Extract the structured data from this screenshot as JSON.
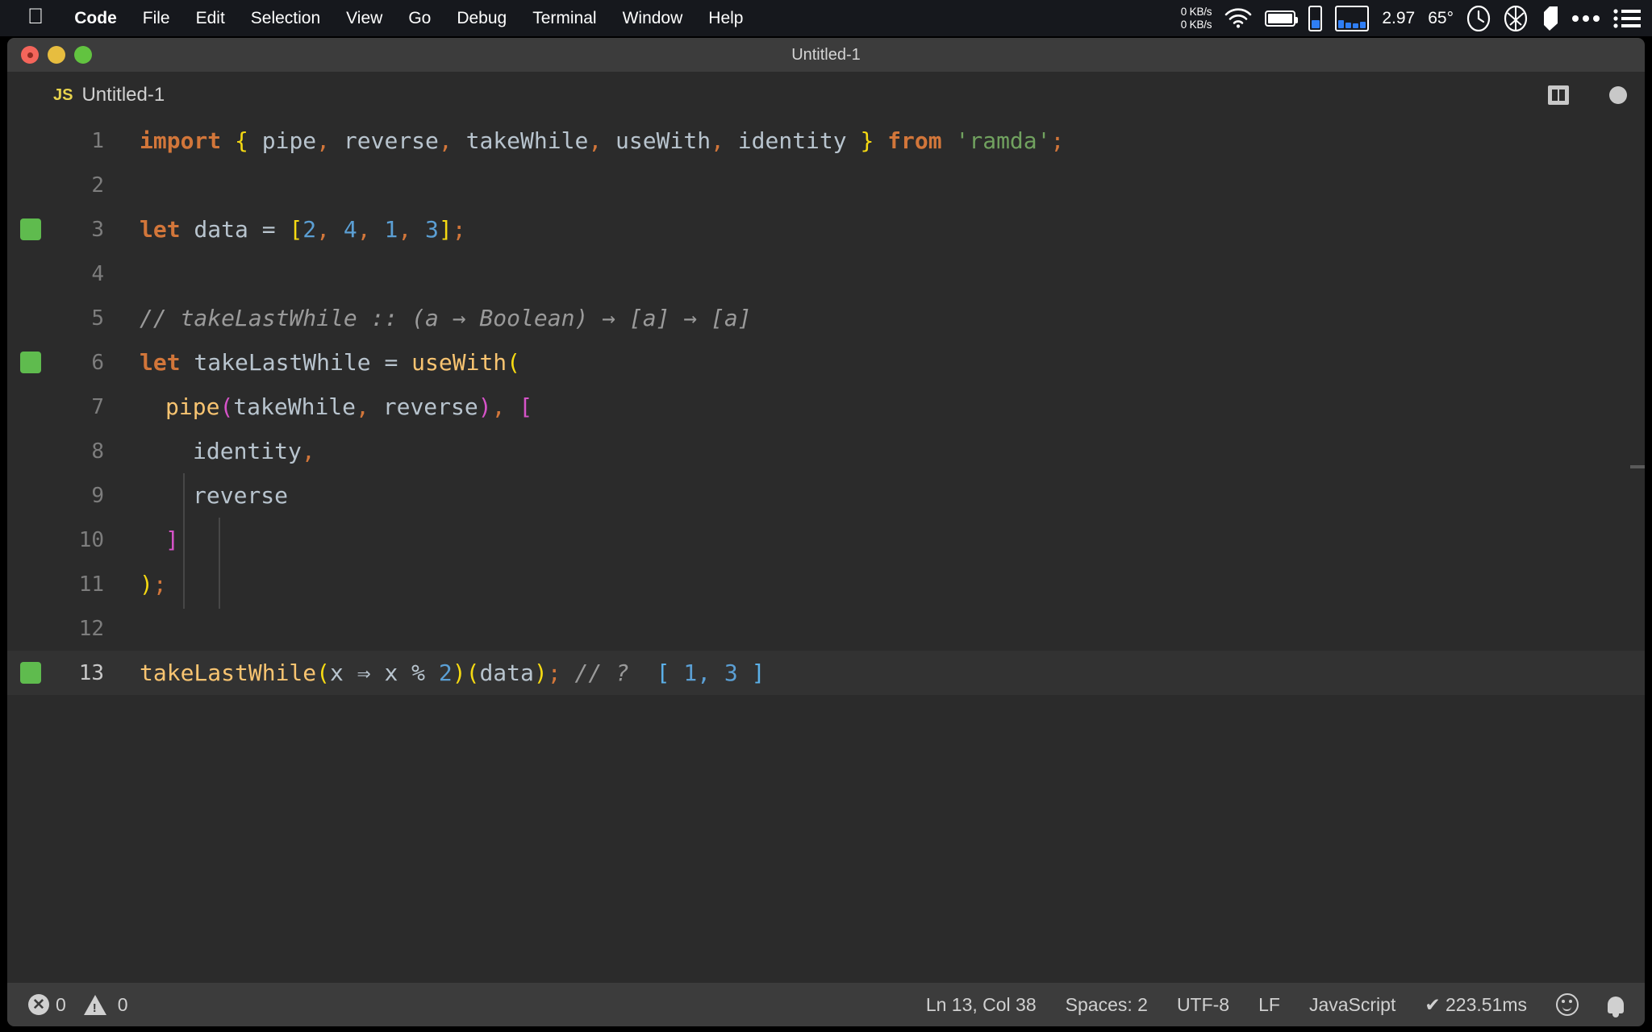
{
  "menubar": {
    "apple_icon": "apple-logo",
    "items": [
      "Code",
      "File",
      "Edit",
      "Selection",
      "View",
      "Go",
      "Debug",
      "Terminal",
      "Window",
      "Help"
    ],
    "status": {
      "net_up": "0 KB/s",
      "net_down": "0 KB/s",
      "wifi_icon": "wifi-icon",
      "battery_icon": "battery-icon",
      "memory_icon": "memory-meter-icon",
      "cpu_histogram_icon": "cpu-histogram-icon",
      "load_value": "2.97",
      "temperature": "65°",
      "gauge_icon": "gauge-icon",
      "aperture_icon": "aperture-icon",
      "shield_icon": "shield-icon",
      "ellipsis_icon": "ellipsis-icon",
      "list_icon": "list-icon"
    }
  },
  "window": {
    "title": "Untitled-1",
    "traffic_lights": [
      "close",
      "minimize",
      "zoom"
    ]
  },
  "tabbar": {
    "badge": "JS",
    "label": "Untitled-1",
    "split_editor_icon": "split-editor-icon",
    "dirty_indicator_icon": "unsaved-dot-icon"
  },
  "editor": {
    "language": "JavaScript",
    "lines": [
      {
        "n": "1",
        "quokka": false,
        "indent_guides": 0
      },
      {
        "n": "2",
        "quokka": false,
        "indent_guides": 0
      },
      {
        "n": "3",
        "quokka": true,
        "indent_guides": 0
      },
      {
        "n": "4",
        "quokka": false,
        "indent_guides": 0
      },
      {
        "n": "5",
        "quokka": false,
        "indent_guides": 0
      },
      {
        "n": "6",
        "quokka": true,
        "indent_guides": 0
      },
      {
        "n": "7",
        "quokka": false,
        "indent_guides": 1
      },
      {
        "n": "8",
        "quokka": false,
        "indent_guides": 2
      },
      {
        "n": "9",
        "quokka": false,
        "indent_guides": 2
      },
      {
        "n": "10",
        "quokka": false,
        "indent_guides": 1
      },
      {
        "n": "11",
        "quokka": false,
        "indent_guides": 0
      },
      {
        "n": "12",
        "quokka": false,
        "indent_guides": 0
      },
      {
        "n": "13",
        "quokka": true,
        "indent_guides": 0,
        "current": true
      }
    ],
    "source_text": [
      "import { pipe, reverse, takeWhile, useWith, identity } from 'ramda';",
      "",
      "let data = [2, 4, 1, 3];",
      "",
      "// takeLastWhile :: (a → Boolean) → [a] → [a]",
      "let takeLastWhile = useWith(",
      "  pipe(takeWhile, reverse), [",
      "    identity,",
      "    reverse",
      "  ]",
      ");",
      "",
      "takeLastWhile(x ⇒ x % 2)(data); // ?  [ 1, 3 ]"
    ],
    "tokens": {
      "l1": [
        "import",
        " ",
        "{",
        " pipe",
        ",",
        " reverse",
        ",",
        " takeWhile",
        ",",
        " useWith",
        ",",
        " identity ",
        "}",
        " ",
        "from",
        " ",
        "'ramda'",
        ";"
      ],
      "l3": [
        "let",
        " data = ",
        "[",
        "2",
        ",",
        " 4",
        ",",
        " 1",
        ",",
        " 3",
        "]",
        ";"
      ],
      "l5": [
        "// takeLastWhile :: (a → Boolean) → [a] → [a]"
      ],
      "l6": [
        "let",
        " takeLastWhile = ",
        "useWith",
        "("
      ],
      "l7": [
        "pipe",
        "(",
        "takeWhile",
        ",",
        " reverse",
        ")",
        ",",
        " ",
        "["
      ],
      "l8": [
        "identity",
        ","
      ],
      "l9": [
        "reverse"
      ],
      "l10": [
        "]"
      ],
      "l11": [
        ")",
        ";"
      ],
      "l13": [
        "takeLastWhile",
        "(",
        "x ⇒ x % ",
        "2",
        ")",
        "(",
        "data",
        ")",
        ";",
        " // ?  ",
        "[",
        " 1, 3 ",
        "]"
      ]
    },
    "colors": {
      "background": "#2b2b2b",
      "current_line": "#323232",
      "keyword": "#d2763a",
      "plain": "#b8c4ce",
      "number": "#5b9fd4",
      "string": "#71a25f",
      "function": "#f8c471",
      "comment": "#9a9a9a",
      "bracket_yellow": "#f5d912",
      "bracket_magenta": "#d653c8",
      "bracket_blue": "#5bb0e8",
      "quokka_green": "#5fbb4e",
      "line_number": "#7d7d7d"
    }
  },
  "statusbar": {
    "errors": "0",
    "warnings": "0",
    "cursor": "Ln 13, Col 38",
    "indentation": "Spaces: 2",
    "encoding": "UTF-8",
    "eol": "LF",
    "language": "JavaScript",
    "quokka_time": "✔ 223.51ms",
    "feedback_icon": "smiley-icon",
    "notifications_icon": "bell-icon"
  }
}
